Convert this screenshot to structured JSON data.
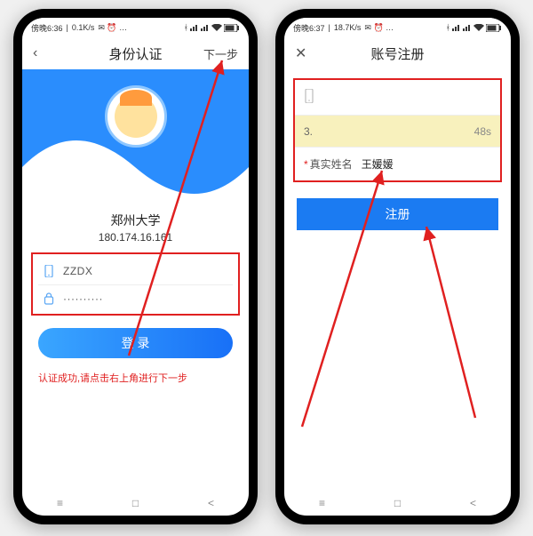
{
  "left": {
    "status": {
      "time": "傍晚6:36",
      "net": "0.1K/s",
      "extras": "✉ ⏰ …"
    },
    "title": "身份认证",
    "next": "下一步",
    "school": "郑州大学",
    "ip": "180.174.16.161",
    "fields": {
      "username": "ZZDX",
      "password": "··········"
    },
    "login_label": "登 录",
    "success": "认证成功,请点击右上角进行下一步"
  },
  "right": {
    "status": {
      "time": "傍晚6:37",
      "net": "18.7K/s",
      "extras": "✉ ⏰ …"
    },
    "title": "账号注册",
    "rows": {
      "code_prefix": "3.",
      "countdown": "48s",
      "name_label": "真实姓名",
      "name_value": "王媛媛"
    },
    "register_label": "注册"
  }
}
